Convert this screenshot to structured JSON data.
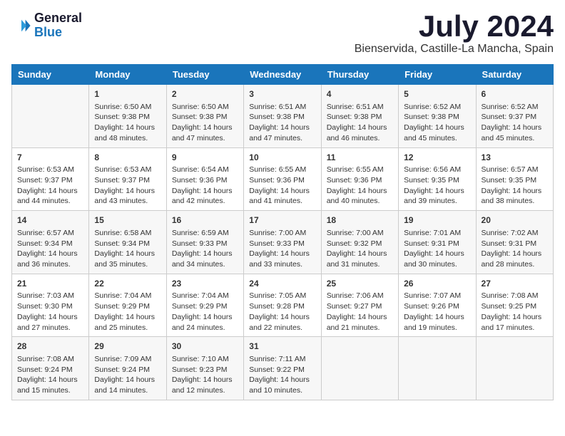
{
  "header": {
    "logo_line1": "General",
    "logo_line2": "Blue",
    "month_year": "July 2024",
    "location": "Bienservida, Castille-La Mancha, Spain"
  },
  "days_of_week": [
    "Sunday",
    "Monday",
    "Tuesday",
    "Wednesday",
    "Thursday",
    "Friday",
    "Saturday"
  ],
  "weeks": [
    [
      {
        "day": "",
        "content": ""
      },
      {
        "day": "1",
        "content": "Sunrise: 6:50 AM\nSunset: 9:38 PM\nDaylight: 14 hours\nand 48 minutes."
      },
      {
        "day": "2",
        "content": "Sunrise: 6:50 AM\nSunset: 9:38 PM\nDaylight: 14 hours\nand 47 minutes."
      },
      {
        "day": "3",
        "content": "Sunrise: 6:51 AM\nSunset: 9:38 PM\nDaylight: 14 hours\nand 47 minutes."
      },
      {
        "day": "4",
        "content": "Sunrise: 6:51 AM\nSunset: 9:38 PM\nDaylight: 14 hours\nand 46 minutes."
      },
      {
        "day": "5",
        "content": "Sunrise: 6:52 AM\nSunset: 9:38 PM\nDaylight: 14 hours\nand 45 minutes."
      },
      {
        "day": "6",
        "content": "Sunrise: 6:52 AM\nSunset: 9:37 PM\nDaylight: 14 hours\nand 45 minutes."
      }
    ],
    [
      {
        "day": "7",
        "content": "Sunrise: 6:53 AM\nSunset: 9:37 PM\nDaylight: 14 hours\nand 44 minutes."
      },
      {
        "day": "8",
        "content": "Sunrise: 6:53 AM\nSunset: 9:37 PM\nDaylight: 14 hours\nand 43 minutes."
      },
      {
        "day": "9",
        "content": "Sunrise: 6:54 AM\nSunset: 9:36 PM\nDaylight: 14 hours\nand 42 minutes."
      },
      {
        "day": "10",
        "content": "Sunrise: 6:55 AM\nSunset: 9:36 PM\nDaylight: 14 hours\nand 41 minutes."
      },
      {
        "day": "11",
        "content": "Sunrise: 6:55 AM\nSunset: 9:36 PM\nDaylight: 14 hours\nand 40 minutes."
      },
      {
        "day": "12",
        "content": "Sunrise: 6:56 AM\nSunset: 9:35 PM\nDaylight: 14 hours\nand 39 minutes."
      },
      {
        "day": "13",
        "content": "Sunrise: 6:57 AM\nSunset: 9:35 PM\nDaylight: 14 hours\nand 38 minutes."
      }
    ],
    [
      {
        "day": "14",
        "content": "Sunrise: 6:57 AM\nSunset: 9:34 PM\nDaylight: 14 hours\nand 36 minutes."
      },
      {
        "day": "15",
        "content": "Sunrise: 6:58 AM\nSunset: 9:34 PM\nDaylight: 14 hours\nand 35 minutes."
      },
      {
        "day": "16",
        "content": "Sunrise: 6:59 AM\nSunset: 9:33 PM\nDaylight: 14 hours\nand 34 minutes."
      },
      {
        "day": "17",
        "content": "Sunrise: 7:00 AM\nSunset: 9:33 PM\nDaylight: 14 hours\nand 33 minutes."
      },
      {
        "day": "18",
        "content": "Sunrise: 7:00 AM\nSunset: 9:32 PM\nDaylight: 14 hours\nand 31 minutes."
      },
      {
        "day": "19",
        "content": "Sunrise: 7:01 AM\nSunset: 9:31 PM\nDaylight: 14 hours\nand 30 minutes."
      },
      {
        "day": "20",
        "content": "Sunrise: 7:02 AM\nSunset: 9:31 PM\nDaylight: 14 hours\nand 28 minutes."
      }
    ],
    [
      {
        "day": "21",
        "content": "Sunrise: 7:03 AM\nSunset: 9:30 PM\nDaylight: 14 hours\nand 27 minutes."
      },
      {
        "day": "22",
        "content": "Sunrise: 7:04 AM\nSunset: 9:29 PM\nDaylight: 14 hours\nand 25 minutes."
      },
      {
        "day": "23",
        "content": "Sunrise: 7:04 AM\nSunset: 9:29 PM\nDaylight: 14 hours\nand 24 minutes."
      },
      {
        "day": "24",
        "content": "Sunrise: 7:05 AM\nSunset: 9:28 PM\nDaylight: 14 hours\nand 22 minutes."
      },
      {
        "day": "25",
        "content": "Sunrise: 7:06 AM\nSunset: 9:27 PM\nDaylight: 14 hours\nand 21 minutes."
      },
      {
        "day": "26",
        "content": "Sunrise: 7:07 AM\nSunset: 9:26 PM\nDaylight: 14 hours\nand 19 minutes."
      },
      {
        "day": "27",
        "content": "Sunrise: 7:08 AM\nSunset: 9:25 PM\nDaylight: 14 hours\nand 17 minutes."
      }
    ],
    [
      {
        "day": "28",
        "content": "Sunrise: 7:08 AM\nSunset: 9:24 PM\nDaylight: 14 hours\nand 15 minutes."
      },
      {
        "day": "29",
        "content": "Sunrise: 7:09 AM\nSunset: 9:24 PM\nDaylight: 14 hours\nand 14 minutes."
      },
      {
        "day": "30",
        "content": "Sunrise: 7:10 AM\nSunset: 9:23 PM\nDaylight: 14 hours\nand 12 minutes."
      },
      {
        "day": "31",
        "content": "Sunrise: 7:11 AM\nSunset: 9:22 PM\nDaylight: 14 hours\nand 10 minutes."
      },
      {
        "day": "",
        "content": ""
      },
      {
        "day": "",
        "content": ""
      },
      {
        "day": "",
        "content": ""
      }
    ]
  ]
}
